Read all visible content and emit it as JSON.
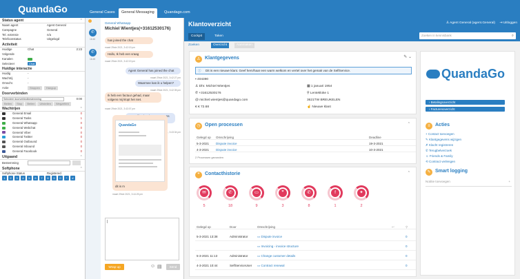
{
  "app": {
    "logo": "QuandaGo"
  },
  "tabs": [
    "General Cases",
    "General Messaging",
    "Quandago.com"
  ],
  "status_agent": {
    "title": "Status agent",
    "rows": [
      [
        "Naam agent",
        "Agent General"
      ],
      [
        "Campagne",
        "General"
      ],
      [
        "Tel. extensie",
        "n/a"
      ],
      [
        "Telefoonstatus",
        "Uitgelogd"
      ]
    ]
  },
  "activiteit": {
    "title": "Activiteit",
    "rows": [
      {
        "k": "Huidige",
        "v": "Chat",
        "n": "2:23"
      },
      {
        "k": "Volgende",
        "v": ""
      },
      {
        "k": "Kanalen",
        "v": ""
      },
      {
        "k": "Selecteer",
        "v": "Chat"
      }
    ]
  },
  "interactie": {
    "title": "Huidige interactie",
    "rows": [
      [
        "Huidig",
        "-"
      ],
      [
        "Wachtrij",
        "-"
      ],
      [
        "Omschr.",
        "-"
      ]
    ],
    "actie_label": "Actie",
    "actie_btns": [
      "Stoppen",
      "Hangup"
    ]
  },
  "doorverbinden": {
    "title": "Doorverbinden",
    "select": "Selecteer doorverbindbestemming",
    "time": "0:00",
    "btns": [
      "Bellen",
      "Stop",
      "Bellen",
      "Uitstellen",
      "Wegzetten"
    ]
  },
  "wachtrijen": {
    "title": "Wachtrijen",
    "items": [
      [
        "General Email",
        "0"
      ],
      [
        "General Tasks",
        "1"
      ],
      [
        "General Whatsapp",
        "0"
      ],
      [
        "General Webchat",
        "0"
      ],
      [
        "General Viber",
        "0"
      ],
      [
        "General Twitter",
        "0"
      ],
      [
        "General Outbound",
        "0"
      ],
      [
        "General Inbound",
        "0"
      ],
      [
        "General Facebook",
        "0"
      ]
    ]
  },
  "uitgaand": {
    "title": "Uitgaand",
    "label": "Bestemming"
  },
  "softphone": {
    "title": "Softphone",
    "status_label": "Softphone Status",
    "status": "Registered",
    "keys": [
      "1",
      "2",
      "3",
      "4",
      "5",
      "6",
      "7",
      "8",
      "9",
      "0",
      "*",
      "#"
    ]
  },
  "chat": {
    "channel": "General Whatsapp",
    "contact": "Michiel Wientjes(+31612530176)",
    "times": [
      "16:40",
      "16:49"
    ],
    "messages": [
      {
        "side": "left",
        "color": "orange",
        "text": "has joined the chat",
        "ts": "maart 29ste 2021, 3:42:19 pm"
      },
      {
        "side": "left",
        "color": "orange",
        "text": "Hallo, Ik heb een vraag",
        "ts": "maart 29ste 2021, 3:42:19 pm"
      },
      {
        "side": "right",
        "color": "blue",
        "text": "Agent General has joined the chat",
        "ts": "maart 29ste 2021, 3:42:27 pm"
      },
      {
        "side": "right",
        "color": "blue",
        "text": "Waarmee kan ik u helpen?",
        "ts": "maart 29ste 2021, 3:42:35 pm"
      },
      {
        "side": "left",
        "color": "orange",
        "text": "Ik heb een factuur gehad, maar volgens mij klopt het niet.",
        "ts": "maart 29ste 2021, 3:43:07 pm"
      },
      {
        "side": "right",
        "color": "blue",
        "text": "Opgeslikt. Ik pak uw gegevens er even bij",
        "ts": "maart 29ste 2021, 3:43:34 pm"
      },
      {
        "side": "left",
        "color": "orange",
        "text": "dit is m",
        "ts": "maart 29ste 2021, 3:44:25 pm"
      }
    ],
    "write_up": "Wrap up",
    "send": "Send"
  },
  "klant": {
    "title": "Klantoverzicht",
    "user": "Agent General (agent.General)",
    "logout": "Uitloggen",
    "subtabs": [
      "Cockpit",
      "Taken"
    ],
    "search_placeholder": "Zoeken in kennisbank",
    "filter_tabs": [
      "Zoeken",
      "Overzicht",
      "Aanmaken"
    ],
    "gegevens": {
      "title": "Klantgegevens",
      "info": "Dit is een nieuwe klant. Geef hem/haar een warm welkom en vertel over het gemak van de SelfService.",
      "left": [
        "404390",
        "Dhr. Michiel Wientjes",
        "+31612530176",
        "michiel.wientjes@quandago.com",
        "€ 72.68"
      ],
      "right": [
        "1 januari 1954",
        "Lentekloke 1",
        "3621TW BREUKELEN",
        "Nieuwe klant"
      ]
    },
    "processen": {
      "title": "Open processen",
      "headers": [
        "Gelegd op",
        "Omschrijving",
        "Deadline"
      ],
      "rows": [
        [
          "5-3-2021",
          "Dispute invoice",
          "19-3-2021"
        ],
        [
          "4-3-2021",
          "Dispute invoice",
          "10-3-2021"
        ]
      ],
      "footer": "2 Processen gevonden"
    },
    "historie": {
      "title": "Contacthistorie",
      "channels": [
        {
          "icon": "✉",
          "n": "5"
        },
        {
          "icon": "✆",
          "n": "18"
        },
        {
          "icon": "▭",
          "n": "9"
        },
        {
          "icon": "❞",
          "n": "3"
        },
        {
          "icon": "✆",
          "n": "8"
        },
        {
          "icon": "f",
          "n": "1"
        },
        {
          "icon": "✦",
          "n": "2"
        }
      ],
      "headers": [
        "Gelegd op",
        "Door",
        "Omschrijving"
      ],
      "rows": [
        [
          "5-3-2021 13:38",
          "Administrator",
          "Dispute invoice",
          "0"
        ],
        [
          "",
          "",
          "Invoicing - invoice structure",
          "0"
        ],
        [
          "5-3-2021 11:13",
          "Administrator",
          "Change customer details",
          "0"
        ],
        [
          "4-3-2021 10:44",
          "SelfServiceUser",
          "Contract renewal",
          "0"
        ]
      ]
    },
    "side": {
      "logo": "QuandaGo",
      "buttons": [
        "Betalingsoverzicht",
        "Facturenoverzicht"
      ],
      "acties_title": "Acties",
      "acties": [
        "Contact toevoegen",
        "Klantgegevens wijzigen",
        "Klacht registreren",
        "Terugbelverzoek",
        "Friends & Family",
        "Contract verlengen"
      ],
      "logging_title": "Smart logging",
      "logging_placeholder": "Notitie toevoegen"
    }
  }
}
